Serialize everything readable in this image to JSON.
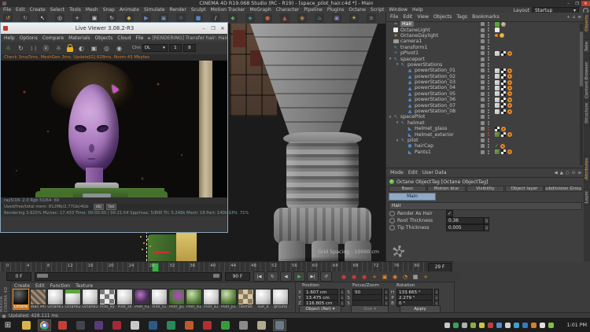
{
  "window": {
    "title": "CINEMA 4D R19.068 Studio (RC - R19) - [space_pilot_hair.c4d *] - Main",
    "layout_label": "Layout",
    "layout_value": "Startup"
  },
  "menubar": [
    "File",
    "Edit",
    "Create",
    "Select",
    "Tools",
    "Mesh",
    "Snap",
    "Animate",
    "Simulate",
    "Render",
    "Sculpt",
    "Motion Tracker",
    "MoGraph",
    "Character",
    "Pipeline",
    "Plugins",
    "Octane",
    "Script",
    "Window",
    "Help"
  ],
  "toolbar_icons": [
    {
      "name": "undo-icon",
      "g": "↺",
      "c": "#d8b84a"
    },
    {
      "name": "redo-icon",
      "g": "↻",
      "c": "#9a9a9a"
    },
    {
      "name": "select-tool-icon",
      "g": "↖",
      "c": "#e0e0e0"
    },
    {
      "name": "live-selection-icon",
      "g": "◎",
      "c": "#d8d8d8"
    },
    {
      "name": "move-tool-icon",
      "g": "+",
      "c": "#c8c8c8"
    },
    {
      "name": "scale-tool-icon",
      "g": "▣",
      "c": "#c8c8c8"
    },
    {
      "name": "rotate-tool-icon",
      "g": "↻",
      "c": "#c8c8c8"
    },
    {
      "name": "coord-system-icon",
      "g": "◆",
      "c": "#d0a848"
    },
    {
      "name": "render-view-icon",
      "g": "▶",
      "c": "#6a8ec0"
    },
    {
      "name": "render-region-icon",
      "g": "▣",
      "c": "#6a8ec0"
    },
    {
      "name": "render-settings-icon",
      "g": "☼",
      "c": "#6a8ec0"
    },
    {
      "name": "cube-primitive-icon",
      "g": "■",
      "c": "#5a84c8"
    },
    {
      "name": "pen-spline-icon",
      "g": "/",
      "c": "#d0d0d0"
    },
    {
      "name": "subdivision-surface-icon",
      "g": "◆",
      "c": "#58a060"
    },
    {
      "name": "mograph-icon",
      "g": "◈",
      "c": "#50a09a"
    },
    {
      "name": "volume-icon",
      "g": "●",
      "c": "#c06038"
    },
    {
      "name": "simulate-icon",
      "g": "▲",
      "c": "#c05848"
    },
    {
      "name": "character-icon",
      "g": "◉",
      "c": "#b08848"
    },
    {
      "name": "environment-icon",
      "g": "⌂",
      "c": "#4a9a8a"
    },
    {
      "name": "camera-icon",
      "g": "▣",
      "c": "#8a8ac8"
    },
    {
      "name": "light-icon",
      "g": "☀",
      "c": "#e8d44a"
    },
    {
      "name": "display-icon",
      "g": "≡",
      "c": "#9a9a9a"
    }
  ],
  "live_viewer": {
    "title": "Live Viewer 3.08.2-R3",
    "menu": [
      "File",
      "Cloud",
      "Objects",
      "Materials",
      "Compare",
      "Options",
      "Help"
    ],
    "render_status": "▸ [RENDERING] Transfer hair: Hair",
    "toolbar": {
      "chn_label": "Chn",
      "chn_value": "DL",
      "spp_from": "1",
      "spp_to": "8"
    },
    "stats_line": "Check 3ms/5ms, MeshGen 3ms, Update[G] 628ms, Room 43 Mbytes",
    "pass_line": "ray5/16: 2.0      Rgb 50/64: 69",
    "mem_line": "Used/free/total mem: 812Mb/2.77Gb/4Gb",
    "chips": [
      "obj",
      "tex"
    ],
    "render_line": "Rendering 3.625%   Mv/sec: 17.433   Time: 00:00:00 / 00:21:54   Spp/max: 5/800   Tri: 5.249k   Mesh: 18   Part: 140k   GPU: 71%"
  },
  "viewport": {
    "grid_spacing": "Grid Spacing : 10000 cm"
  },
  "object_manager": {
    "menu": [
      "File",
      "Edit",
      "View",
      "Objects",
      "Tags",
      "Bookmarks"
    ],
    "items": [
      {
        "label": "Hair",
        "depth": 0,
        "icon": "hair",
        "selected": true,
        "tags": [
          "chip-green",
          "chip-face"
        ]
      },
      {
        "label": "OctaneLight",
        "depth": 0,
        "icon": "light",
        "tags": [
          "chip-white"
        ]
      },
      {
        "label": "OctaneDaylight",
        "depth": 0,
        "icon": "sun",
        "tags": [
          "dot-orange",
          "chip-sun"
        ]
      },
      {
        "label": "camera1",
        "depth": 0,
        "icon": "camera",
        "tags": []
      },
      {
        "label": "transform1",
        "depth": 0,
        "icon": "null",
        "tags": []
      },
      {
        "label": "pPivot1",
        "depth": 0,
        "icon": "axis",
        "tags": [
          "chip-tex",
          "chip-checker",
          "chip-target"
        ]
      },
      {
        "label": "spaceport",
        "depth": 0,
        "icon": "null",
        "expanded": true,
        "tags": []
      },
      {
        "label": "powerStations",
        "depth": 1,
        "icon": "null",
        "expanded": true,
        "tags": []
      },
      {
        "label": "powerStation_01",
        "depth": 2,
        "icon": "instance",
        "tags": [
          "chip-tex",
          "chip-checker",
          "chip-target"
        ]
      },
      {
        "label": "powerStation_02",
        "depth": 2,
        "icon": "instance",
        "tags": [
          "chip-tex",
          "chip-checker",
          "chip-target"
        ]
      },
      {
        "label": "powerStation_03",
        "depth": 2,
        "icon": "instance",
        "tags": [
          "chip-tex",
          "chip-checker",
          "chip-target"
        ]
      },
      {
        "label": "powerStation_04",
        "depth": 2,
        "icon": "instance",
        "tags": [
          "chip-tex",
          "chip-checker",
          "chip-target"
        ]
      },
      {
        "label": "powerStation_05",
        "depth": 2,
        "icon": "instance",
        "tags": [
          "chip-tex",
          "chip-checker",
          "chip-target"
        ]
      },
      {
        "label": "powerStation_06",
        "depth": 2,
        "icon": "instance",
        "tags": [
          "chip-tex",
          "chip-checker",
          "chip-target"
        ]
      },
      {
        "label": "powerStation_07",
        "depth": 2,
        "icon": "instance",
        "tags": [
          "chip-tex",
          "chip-checker",
          "chip-target"
        ]
      },
      {
        "label": "powerStation_08",
        "depth": 2,
        "icon": "instance",
        "tags": [
          "chip-tex",
          "chip-checker",
          "chip-target"
        ]
      },
      {
        "label": "spacePilot",
        "depth": 0,
        "icon": "null",
        "expanded": true,
        "tags": []
      },
      {
        "label": "helmet",
        "depth": 1,
        "icon": "null",
        "expanded": true,
        "tags": []
      },
      {
        "label": "Helmet_glass",
        "depth": 2,
        "icon": "poly",
        "dots": "red",
        "tags": [
          "chip-checker",
          "chip-target"
        ]
      },
      {
        "label": "Helmet_exterior",
        "depth": 2,
        "icon": "poly",
        "dots": "red",
        "tags": [
          "chip-texgreen",
          "chip-checker",
          "chip-target"
        ]
      },
      {
        "label": "pilot",
        "depth": 1,
        "icon": "null",
        "expanded": true,
        "tags": []
      },
      {
        "label": "hairCap",
        "depth": 2,
        "icon": "sphere",
        "tags": [
          "chip-check",
          "chip-target"
        ]
      },
      {
        "label": "Pants1",
        "depth": 2,
        "icon": "poly",
        "tags": [
          "chip-texgreen",
          "chip-checker",
          "chip-target"
        ]
      }
    ]
  },
  "attribute_manager": {
    "menu": [
      "Mode",
      "Edit",
      "User Data"
    ],
    "title": "Octane ObjectTag [Octane ObjectTag]",
    "tabs_row1": [
      "Basic",
      "Motion blur",
      "Visibility",
      "Object layer",
      "Subdivision Group"
    ],
    "active_tab": "Main",
    "section": "Hair",
    "rows": [
      {
        "label": "Render As Hair",
        "type": "check",
        "checked": true
      },
      {
        "label": "Root Thickness",
        "type": "value",
        "value": "0.36"
      },
      {
        "label": "Tip Thickness",
        "type": "value",
        "value": "0.005"
      }
    ]
  },
  "side_tabs": {
    "top": [
      "Objects",
      "Take",
      "Content Browser",
      "Structure"
    ],
    "bottom": [
      "Attributes",
      "Layer"
    ]
  },
  "timeline": {
    "tick_labels": [
      "0",
      "4",
      "8",
      "12",
      "16",
      "20",
      "24",
      "28",
      "32",
      "36",
      "40",
      "44",
      "48",
      "52",
      "56",
      "60",
      "64",
      "68",
      "72",
      "76",
      "80"
    ],
    "current_frame": 29,
    "frame_label": "29 F",
    "range_start": "0 F",
    "range_end": "90 F",
    "transport": [
      {
        "name": "goto-start-button",
        "g": "|◀"
      },
      {
        "name": "loop-button",
        "g": "↻"
      },
      {
        "name": "play-backward-button",
        "g": "◀"
      },
      {
        "name": "play-button",
        "g": "▶",
        "accent": true
      },
      {
        "name": "goto-end-button",
        "g": "▶|"
      },
      {
        "name": "repeat-button",
        "g": "↺"
      }
    ],
    "record": [
      {
        "name": "record-keyframe-icon",
        "g": "●",
        "c": "#c23a3a"
      },
      {
        "name": "record-position-icon",
        "g": "●",
        "c": "#c23a3a"
      },
      {
        "name": "record-autokey-icon",
        "g": "●",
        "c": "#c23a3a"
      },
      {
        "name": "keyframe-add-icon",
        "g": "+",
        "c": "#e08a2e"
      },
      {
        "name": "keyframe-box-icon",
        "g": "▣",
        "c": "#e08a2e"
      },
      {
        "name": "keyframe-circle-icon",
        "g": "◉",
        "c": "#e08a2e"
      },
      {
        "name": "keyframe-clock-icon",
        "g": "◔",
        "c": "#e08a2e"
      },
      {
        "name": "snap-grid-icon",
        "g": "▦",
        "c": "#c8c8c8"
      },
      {
        "name": "key-icon",
        "g": "+",
        "c": "#e08a2e"
      }
    ]
  },
  "materials": {
    "menu": [
      "Create",
      "Edit",
      "Function",
      "Texture"
    ],
    "items": [
      {
        "name": "Octane",
        "style": "dark",
        "selected": true
      },
      {
        "name": "Wall Mtl",
        "style": "hatch"
      },
      {
        "name": "Octane1",
        "style": "plain"
      },
      {
        "name": "Octane2",
        "style": "greenband"
      },
      {
        "name": "Octane3",
        "style": "plain"
      },
      {
        "name": "Pilot_ey",
        "style": "checker"
      },
      {
        "name": "Pilot_sk",
        "style": "plain"
      },
      {
        "name": "Pilot_h1",
        "style": "purple"
      },
      {
        "name": "Pilot_s1",
        "style": "plain"
      },
      {
        "name": "Pilot_g1",
        "style": "greenpurple"
      },
      {
        "name": "Pilot_b1",
        "style": "green"
      },
      {
        "name": "Pilot_a1",
        "style": "plain"
      },
      {
        "name": "Pilot_p1",
        "style": "green"
      },
      {
        "name": "helmet",
        "style": "checkerbeige"
      },
      {
        "name": "suit_b",
        "style": "plain"
      },
      {
        "name": "ground",
        "style": "plain"
      }
    ]
  },
  "coordinates": {
    "headers": [
      "Position",
      "Focus/Zoom",
      "Rotation"
    ],
    "rows": [
      {
        "l1": "X",
        "v1": "1.607 cm",
        "l2": "S",
        "v2": "50",
        "l3": "H",
        "v3": "133.665 °"
      },
      {
        "l1": "Y",
        "v1": "13.475 cm",
        "l2": "S",
        "v2": "",
        "l3": "P",
        "v3": "2.279 °"
      },
      {
        "l1": "Z",
        "v1": "116.805 cm",
        "l2": "S",
        "v2": "",
        "l3": "B",
        "v3": "0 °"
      }
    ],
    "mode": "Object (Rel)",
    "size_label": "Size",
    "apply_label": "Apply"
  },
  "statusbar": {
    "text": "Updated: 428.111 ms"
  },
  "taskbar": {
    "clock": "1:01 PM",
    "apps": [
      {
        "name": "file-explorer",
        "c": "#d8b44a"
      },
      {
        "name": "chrome",
        "c": "chrome",
        "active": true
      },
      {
        "name": "app-red",
        "c": "#c04038"
      },
      {
        "name": "app-dark",
        "c": "#44444e"
      },
      {
        "name": "maxon",
        "c": "#5a3a7a"
      },
      {
        "name": "app-crimson",
        "c": "#a02a3a"
      },
      {
        "name": "photos",
        "c": "#c8c8c8"
      },
      {
        "name": "photoshop",
        "c": "#2a5a8a"
      },
      {
        "name": "app-green-c",
        "c": "#2a8a5a"
      },
      {
        "name": "app-orange",
        "c": "#c05a2a"
      },
      {
        "name": "app-red-2",
        "c": "#b03030"
      },
      {
        "name": "app-green-dot",
        "c": "#3a9a3a"
      },
      {
        "name": "app-gray",
        "c": "#8a8a8a"
      },
      {
        "name": "app-beige",
        "c": "#b0a890"
      },
      {
        "name": "cinema4d",
        "c": "#6a7a8a",
        "active": true
      }
    ],
    "tray": [
      "#c8c8c8",
      "#3aa05a",
      "#b0b0b0",
      "#88b040",
      "#c8c840",
      "#c04040",
      "#4a90d0",
      "#d0d0d0",
      "#40a0d0",
      "#3a7ac0",
      "#d08030",
      "#e0e0e0",
      "#80c040"
    ]
  }
}
